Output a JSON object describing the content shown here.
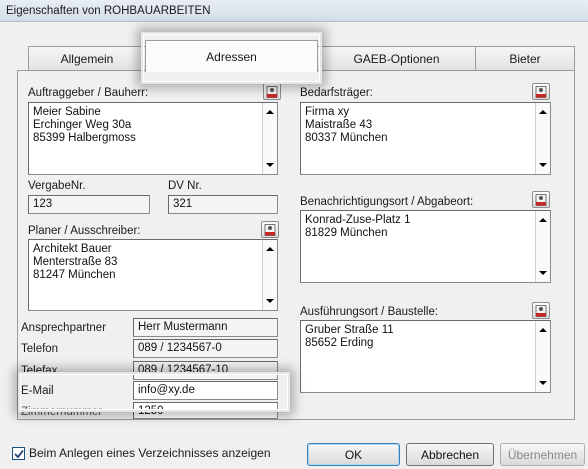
{
  "window": {
    "title": "Eigenschaften von ROHBAUARBEITEN"
  },
  "tabs": [
    {
      "label": "Allgemein",
      "active": false
    },
    {
      "label": "Adressen",
      "active": true
    },
    {
      "label": "GAEB-Optionen",
      "active": false
    },
    {
      "label": "Bieter",
      "active": false
    }
  ],
  "auftraggeber": {
    "label": "Auftraggeber / Bauherr:",
    "lines": [
      "Meier  Sabine",
      "Erchinger Weg 30a",
      "85399 Halbergmoss"
    ]
  },
  "vergabe": {
    "label": "VergabeNr.",
    "value": "123"
  },
  "dv": {
    "label": "DV Nr.",
    "value": "321"
  },
  "planer": {
    "label": "Planer / Ausschreiber:",
    "lines": [
      "Architekt Bauer",
      "Menterstraße 83",
      "81247 München"
    ]
  },
  "contact": {
    "ansprechpartner": {
      "label": "Ansprechpartner",
      "value": "Herr Mustermann"
    },
    "telefon": {
      "label": "Telefon",
      "value": "089 / 1234567-0"
    },
    "telefax": {
      "label": "Telefax",
      "value": "089 / 1234567-10"
    },
    "email": {
      "label": "E-Mail",
      "value": "info@xy.de"
    },
    "zimmer": {
      "label": "Zimmernummer",
      "value": "1250"
    }
  },
  "bedarfstraeger": {
    "label": "Bedarfsträger:",
    "lines": [
      "Firma xy",
      "Maistraße 43",
      "80337 München"
    ]
  },
  "benachrichtigung": {
    "label": "Benachrichtigungsort / Abgabeort:",
    "lines": [
      "Konrad-Zuse-Platz 1",
      "81829 München"
    ]
  },
  "ausfuehrung": {
    "label": "Ausführungsort / Baustelle:",
    "lines": [
      "Gruber Straße 11",
      "85652 Erding"
    ]
  },
  "footer": {
    "checkbox_label": "Beim Anlegen eines Verzeichnisses anzeigen",
    "checkbox_checked": true,
    "ok": "OK",
    "cancel": "Abbrechen",
    "apply": "Übernehmen"
  },
  "icons": {
    "address_book": "address-book-icon",
    "scroll_up": "scroll-up-arrow-icon",
    "scroll_down": "scroll-down-arrow-icon",
    "check": "checkmark-icon"
  },
  "colors": {
    "accent_border": "#3c7fb1",
    "title_bg": "#d3dce8",
    "panel_bg": "#f0f0f0"
  }
}
